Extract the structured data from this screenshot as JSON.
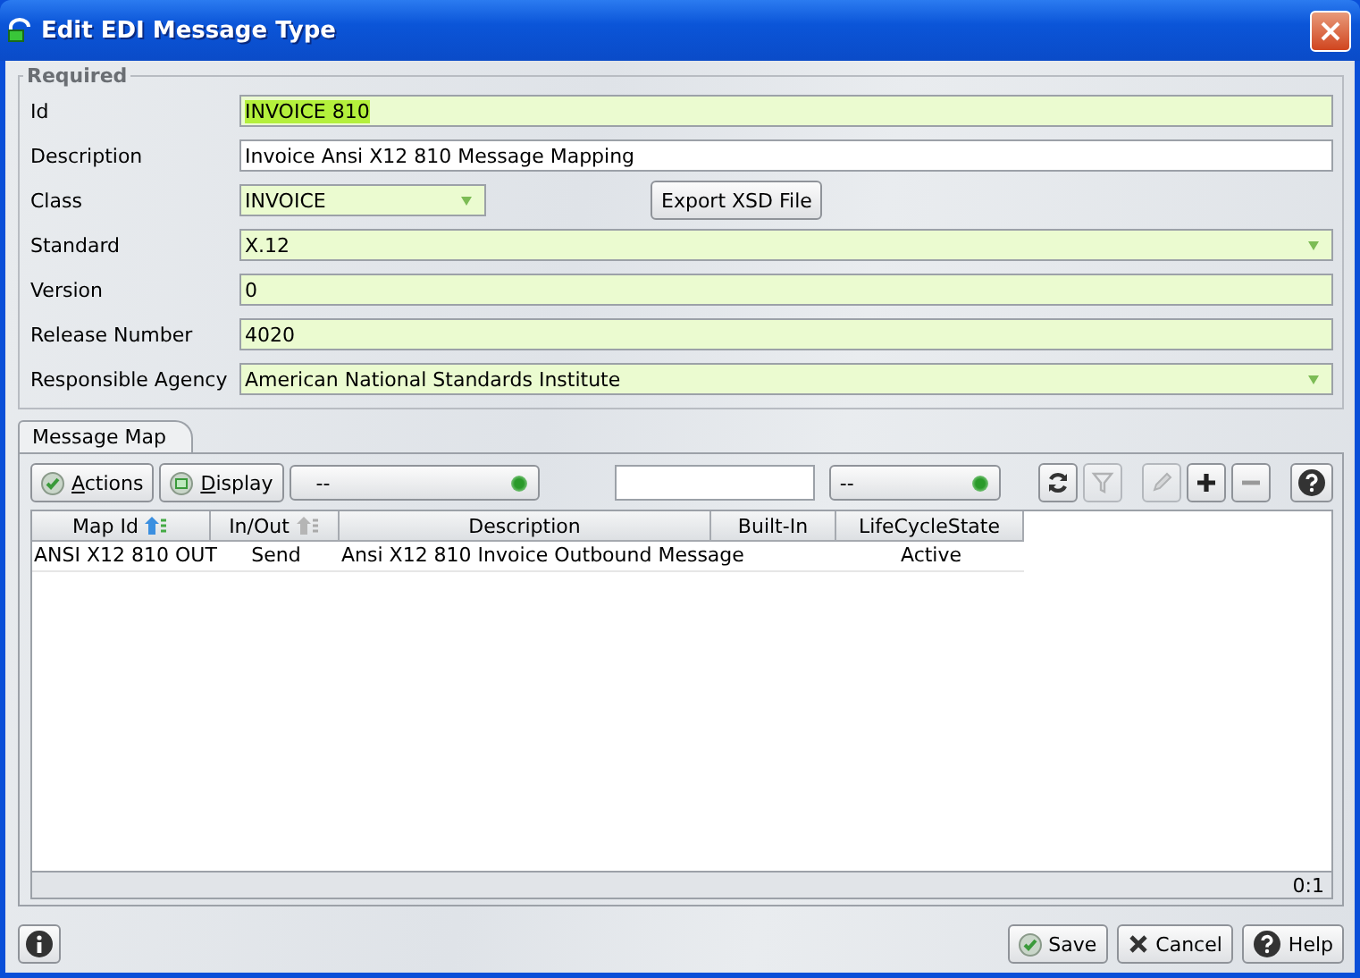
{
  "window": {
    "title": "Edit EDI Message Type"
  },
  "required_group": {
    "title": "Required",
    "fields": [
      {
        "label": "Id",
        "kind": "text",
        "value": "INVOICE 810",
        "required": true,
        "text_selected": true
      },
      {
        "label": "Description",
        "kind": "text",
        "value": "Invoice Ansi X12 810 Message Mapping",
        "required": false,
        "text_selected": false
      },
      {
        "label": "Class",
        "kind": "short-dropdown",
        "value": "INVOICE",
        "required": true,
        "text_selected": false,
        "button": "Export XSD File"
      },
      {
        "label": "Standard",
        "kind": "dropdown",
        "value": "X.12",
        "required": true,
        "text_selected": false
      },
      {
        "label": "Version",
        "kind": "text",
        "value": "0",
        "required": true,
        "text_selected": false
      },
      {
        "label": "Release Number",
        "kind": "text",
        "value": "4020",
        "required": true,
        "text_selected": false
      },
      {
        "label": "Responsible Agency",
        "kind": "dropdown",
        "value": "American National Standards Institute",
        "required": true,
        "text_selected": false
      }
    ]
  },
  "tabs": [
    {
      "label": "Message Map",
      "selected": true
    }
  ],
  "toolbar": {
    "buttons": [
      {
        "label": "Actions"
      },
      {
        "label": "Display"
      }
    ],
    "filter_dropdown_1": {
      "value": "--"
    },
    "filter_dropdown_2": {
      "value": "--"
    },
    "tools": [
      {
        "disabled": false
      },
      {
        "disabled": true
      },
      {
        "disabled": true
      },
      {
        "disabled": false
      },
      {
        "disabled": false
      },
      {
        "disabled": false
      }
    ]
  },
  "table": {
    "columns": [
      {
        "label": "Map Id",
        "sorted": true
      },
      {
        "label": "In/Out",
        "sorted": false
      },
      {
        "label": "Description"
      },
      {
        "label": "Built-In"
      },
      {
        "label": "LifeCycleState"
      }
    ],
    "rows": [
      {
        "cells": [
          "ANSI X12 810 OUT",
          "Send",
          "Ansi X12 810 Invoice Outbound Message",
          null,
          "Active"
        ]
      }
    ]
  },
  "status_bar": {
    "count": "0:1"
  },
  "footer": {
    "buttons": [
      {
        "label": "Save"
      },
      {
        "label": "Cancel"
      },
      {
        "label": "Help"
      }
    ]
  }
}
